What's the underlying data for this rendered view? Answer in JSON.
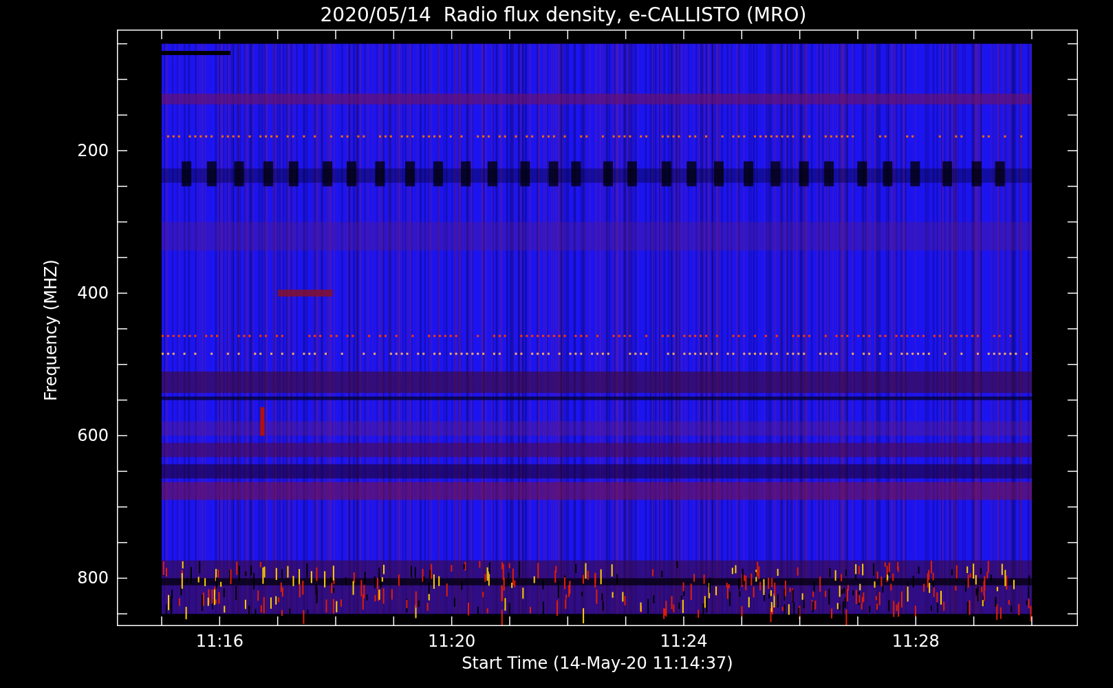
{
  "title": "2020/05/14  Radio flux density, e-CALLISTO (MRO)",
  "y_axis": {
    "label": "Frequency (MHZ)",
    "ticks": [
      "200",
      "400",
      "600",
      "800"
    ]
  },
  "x_axis": {
    "label": "Start Time (14-May-20 11:14:37)",
    "ticks": [
      "11:16",
      "11:20",
      "11:24",
      "11:28"
    ]
  }
}
